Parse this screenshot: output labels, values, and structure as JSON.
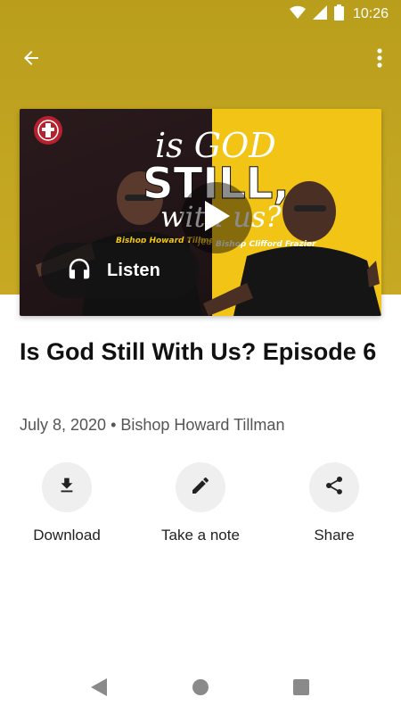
{
  "status_bar": {
    "time": "10:26",
    "icons": [
      "wifi-icon",
      "signal-icon",
      "battery-icon"
    ]
  },
  "app_bar": {
    "back_icon": "arrow-back-icon",
    "more_icon": "more-vertical-icon"
  },
  "artwork": {
    "headline_line1": "is GOD",
    "headline_line2": "STILL,",
    "headline_line3": "with us?",
    "featuring": "featuring",
    "speaker_left": "Bishop Howard Tillman",
    "speaker_right": "Bishop Clifford Frazier",
    "left_color": "#221518",
    "right_color": "#f2c416"
  },
  "player": {
    "play_icon": "play-icon",
    "listen_icon": "headphones-icon",
    "listen_label": "Listen"
  },
  "episode": {
    "title": "Is God Still With Us? Episode 6",
    "meta": "July 8, 2020 • Bishop Howard Tillman"
  },
  "actions": [
    {
      "label": "Download",
      "icon": "download-icon"
    },
    {
      "label": "Take a note",
      "icon": "pencil-icon"
    },
    {
      "label": "Share",
      "icon": "share-icon"
    }
  ],
  "nav_bar": {
    "icons": [
      "nav-back-icon",
      "nav-home-icon",
      "nav-recents-icon"
    ]
  },
  "colors": {
    "header_gold": "#c2a521",
    "accent_yellow": "#f2c416",
    "action_circle": "#efefef"
  }
}
